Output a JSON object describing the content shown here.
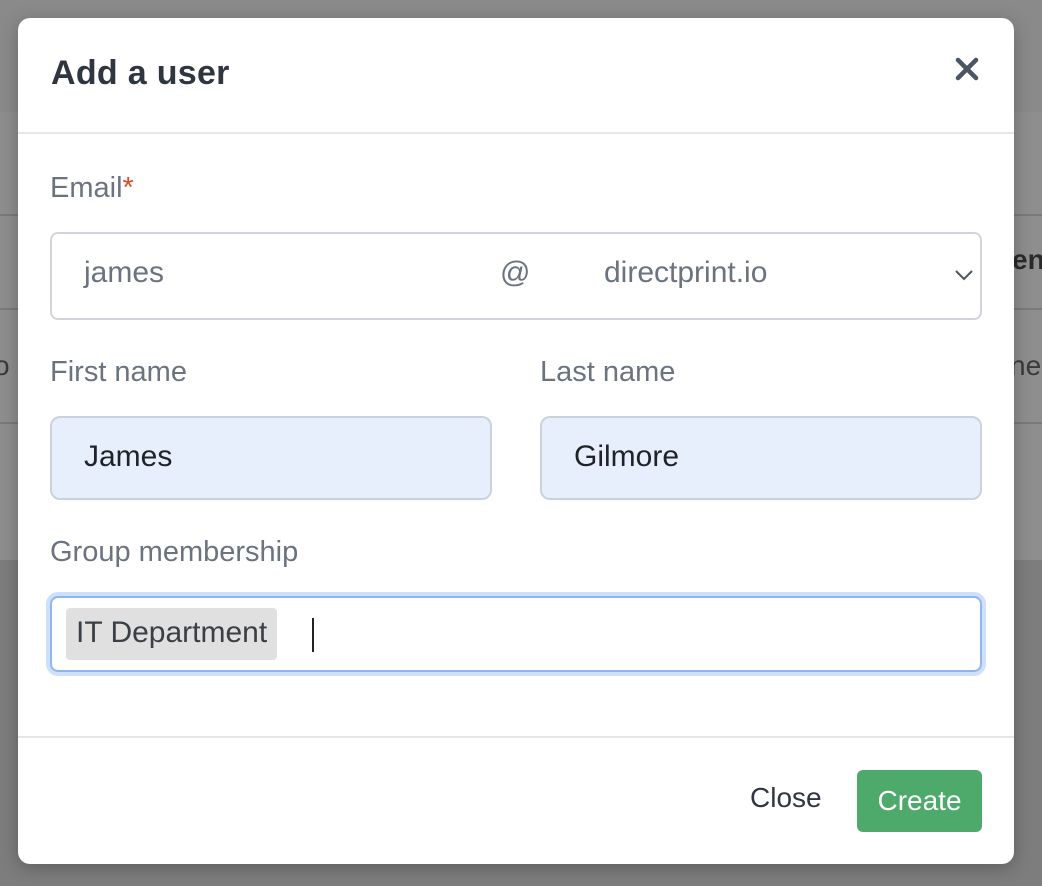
{
  "modal": {
    "title": "Add a user",
    "close_icon": "close-icon"
  },
  "email": {
    "label": "Email",
    "required_mark": "*",
    "username": "james",
    "at_symbol": "@",
    "domain": "directprint.io",
    "domain_icon": "chevron-down-icon"
  },
  "first_name": {
    "label": "First name",
    "value": "James"
  },
  "last_name": {
    "label": "Last name",
    "value": "Gilmore"
  },
  "group_membership": {
    "label": "Group membership",
    "tags": [
      "IT Department"
    ]
  },
  "footer": {
    "close_label": "Close",
    "create_label": "Create"
  },
  "background_fragments": [
    "en",
    "o",
    "ne"
  ],
  "colors": {
    "create_button": "#4daa6a",
    "required_mark": "#e0492a",
    "autofill_bg": "#e8effc",
    "focus_ring": "#8fb6f0"
  }
}
